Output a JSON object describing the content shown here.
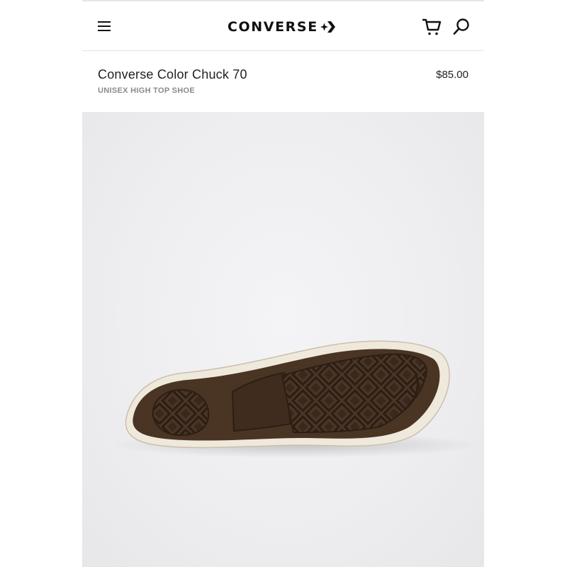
{
  "header": {
    "brand": "CONVERSE",
    "icons": {
      "menu": "hamburger-menu-icon",
      "cart": "cart-icon",
      "search": "search-icon",
      "logo_mark": "star-chevron-icon"
    }
  },
  "product": {
    "title": "Converse Color Chuck 70",
    "subtitle": "UNISEX HIGH TOP SHOE",
    "price": "$85.00"
  },
  "colors": {
    "text": "#111111",
    "subtle": "#8a8a8a",
    "image_bg": "#eeeef0",
    "sole_rubber": "#4a3424",
    "sole_foxing": "#efe9dc",
    "upper": "#8a6a66"
  }
}
